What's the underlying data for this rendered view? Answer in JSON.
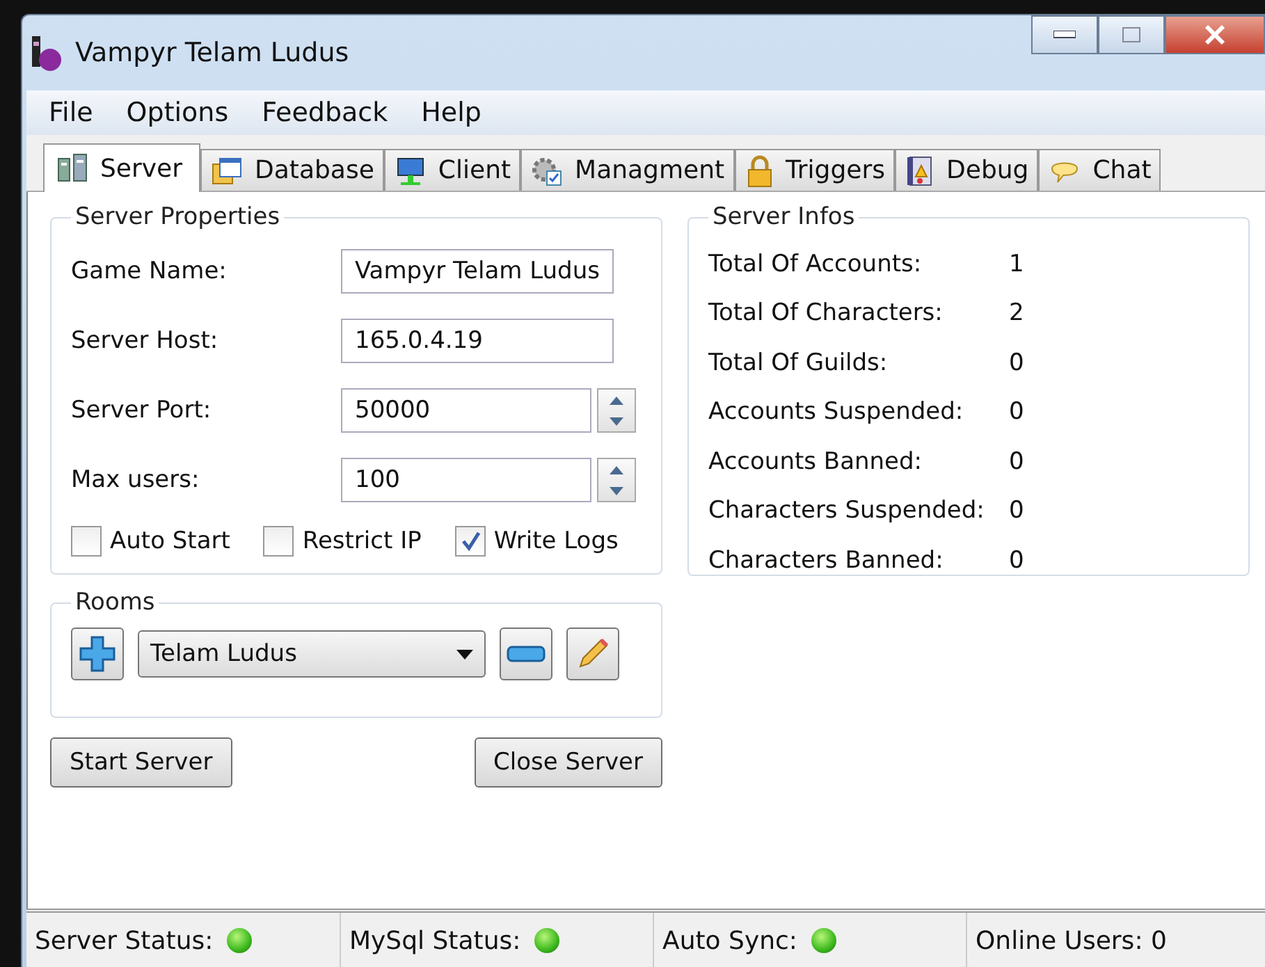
{
  "window": {
    "title": "Vampyr Telam Ludus"
  },
  "menu": [
    "File",
    "Options",
    "Feedback",
    "Help"
  ],
  "tabs": [
    {
      "label": "Server",
      "kind": "server",
      "selected": true
    },
    {
      "label": "Database",
      "kind": "database",
      "selected": false
    },
    {
      "label": "Client",
      "kind": "client",
      "selected": false
    },
    {
      "label": "Managment",
      "kind": "gear",
      "selected": false
    },
    {
      "label": "Triggers",
      "kind": "lock",
      "selected": false
    },
    {
      "label": "Debug",
      "kind": "debug",
      "selected": false
    },
    {
      "label": "Chat",
      "kind": "chat",
      "selected": false
    }
  ],
  "server_properties": {
    "title": "Server Properties",
    "fields": [
      {
        "label": "Game Name:",
        "value": "Vampyr Telam Ludus",
        "kind": "text"
      },
      {
        "label": "Server Host:",
        "value": "165.0.4.19",
        "kind": "text"
      },
      {
        "label": "Server Port:",
        "value": "50000",
        "kind": "spin"
      },
      {
        "label": "Max users:",
        "value": "100",
        "kind": "spin"
      }
    ],
    "checkboxes": [
      {
        "label": "Auto Start",
        "checked": false
      },
      {
        "label": "Restrict IP",
        "checked": false
      },
      {
        "label": "Write Logs",
        "checked": true
      }
    ]
  },
  "rooms": {
    "title": "Rooms",
    "selected_room": "Telam Ludus"
  },
  "buttons": [
    "Start Server",
    "Close Server"
  ],
  "server_infos": {
    "title": "Server Infos",
    "rows": [
      {
        "label": "Total Of Accounts:",
        "value": "1"
      },
      {
        "label": "Total Of Characters:",
        "value": "2"
      },
      {
        "label": "Total Of Guilds:",
        "value": "0"
      },
      {
        "label": "Accounts Suspended:",
        "value": "0"
      },
      {
        "label": "Accounts Banned:",
        "value": "0"
      },
      {
        "label": "Characters Suspended:",
        "value": "0"
      },
      {
        "label": "Characters Banned:",
        "value": "0"
      }
    ]
  },
  "status_bar": [
    {
      "label": "Server Status:",
      "on": true
    },
    {
      "label": "MySql Status:",
      "on": true
    },
    {
      "label": "Auto Sync:",
      "on": true
    },
    {
      "label": "Online Users: 0"
    }
  ]
}
